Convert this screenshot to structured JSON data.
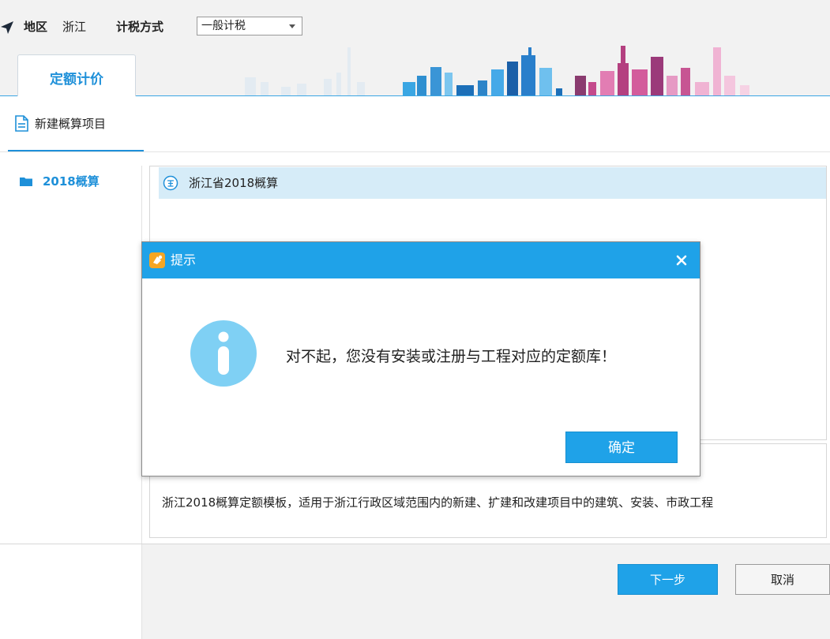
{
  "header": {
    "region_label": "地区",
    "region_value": "浙江",
    "tax_label": "计税方式",
    "tax_select_value": "一般计税"
  },
  "tabs": [
    {
      "label": "定额计价"
    }
  ],
  "toolbar": {
    "new_project_label": "新建概算项目"
  },
  "tree": {
    "items": [
      {
        "label": "2018概算"
      }
    ]
  },
  "list": {
    "items": [
      {
        "label": "浙江省2018概算"
      }
    ]
  },
  "description": "浙江2018概算定额模板，适用于浙江行政区域范围内的新建、扩建和改建项目中的建筑、安装、市政工程",
  "footer": {
    "next_label": "下一步",
    "cancel_label": "取消"
  },
  "dialog": {
    "title": "提示",
    "message": "对不起，您没有安装或注册与工程对应的定额库！",
    "ok_label": "确定"
  },
  "colors": {
    "accent": "#1fa2e8",
    "selected_row": "#d6ecf8",
    "info_icon": "#7fd0f4"
  },
  "icons": {
    "nav": "navigation-arrow-icon",
    "new_project": "document-icon",
    "tree_folder": "folder-icon",
    "quota": "ding-badge-icon",
    "dialog_app": "app-logo-icon",
    "dialog_close": "close-icon",
    "dialog_info": "info-icon"
  }
}
